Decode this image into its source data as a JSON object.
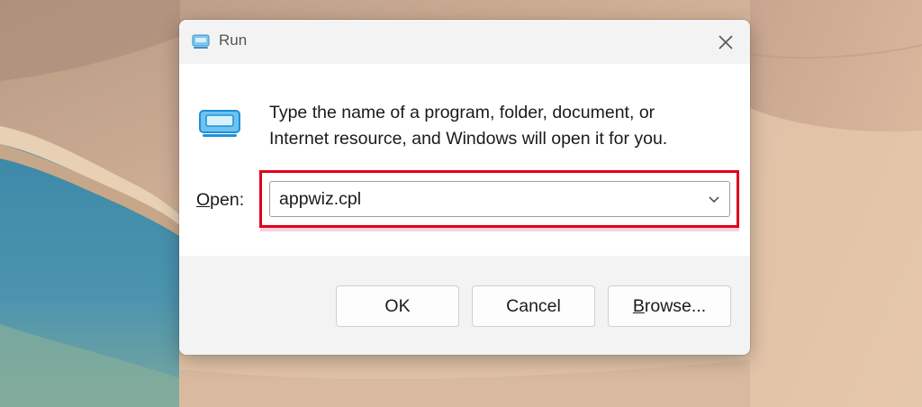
{
  "window": {
    "title": "Run"
  },
  "dialog": {
    "instructions_line1": "Type the name of a program, folder, document, or",
    "instructions_line2": "Internet resource, and Windows will open it for you.",
    "open_label_mnemonic": "O",
    "open_label_rest": "pen:",
    "input_value": "appwiz.cpl"
  },
  "buttons": {
    "ok": "OK",
    "cancel": "Cancel",
    "browse_mnemonic": "B",
    "browse_rest": "rowse..."
  },
  "icons": {
    "title": "run-icon",
    "program": "run-program-icon",
    "close": "close-icon",
    "dropdown": "chevron-down-icon"
  },
  "colors": {
    "highlight": "#e0001b",
    "accent_icon": "#3ba7e6"
  }
}
